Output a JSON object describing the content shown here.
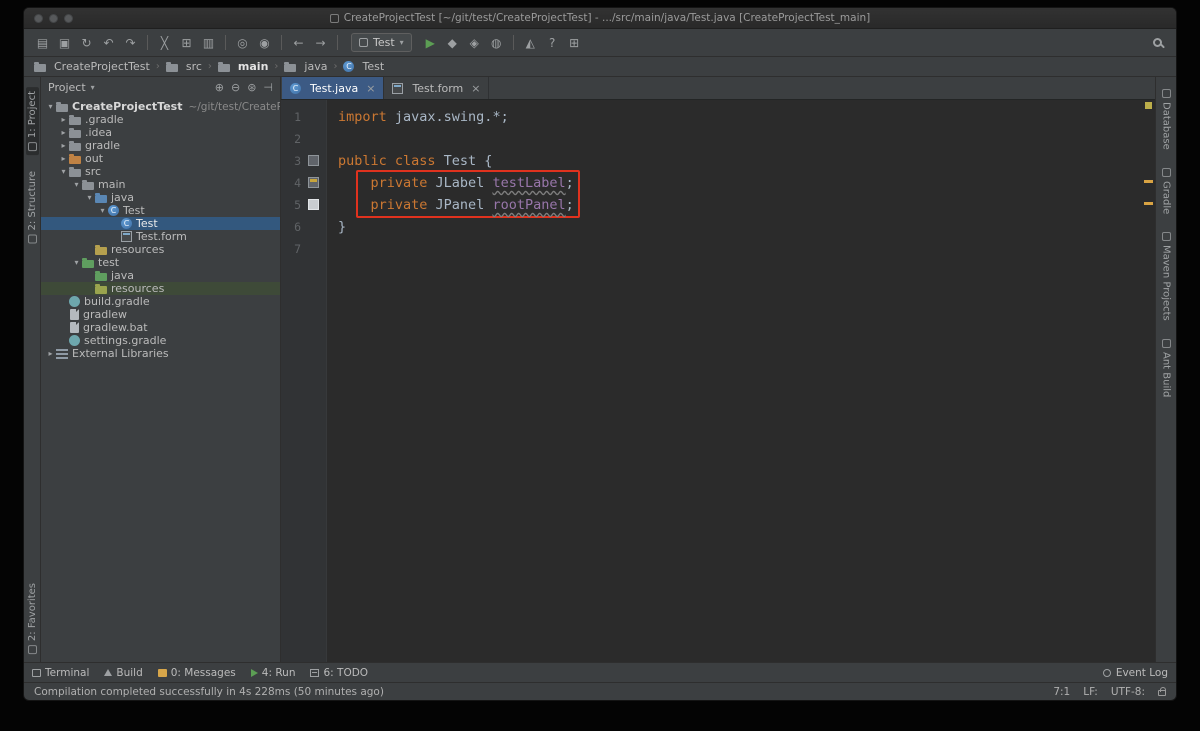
{
  "window": {
    "title": "CreateProjectTest [~/git/test/CreateProjectTest] - .../src/main/java/Test.java [CreateProjectTest_main]"
  },
  "toolbar": {
    "groups": [
      {
        "icons": [
          {
            "name": "open-icon",
            "glyph": "▤"
          },
          {
            "name": "save-all-icon",
            "glyph": "▣"
          },
          {
            "name": "synchronize-icon",
            "glyph": "↻"
          },
          {
            "name": "undo-icon",
            "glyph": "↶"
          },
          {
            "name": "redo-icon",
            "glyph": "↷"
          }
        ]
      },
      {
        "icons": [
          {
            "name": "cut-icon",
            "glyph": "╳"
          },
          {
            "name": "copy-icon",
            "glyph": "⊞"
          },
          {
            "name": "paste-icon",
            "glyph": "▥"
          }
        ]
      },
      {
        "icons": [
          {
            "name": "find-icon",
            "glyph": "◎"
          },
          {
            "name": "replace-icon",
            "glyph": "◉"
          }
        ]
      },
      {
        "icons": [
          {
            "name": "back-icon",
            "glyph": "←"
          },
          {
            "name": "forward-icon",
            "glyph": "→"
          }
        ]
      }
    ],
    "run_config_label": "Test",
    "run_icons": [
      {
        "name": "run-icon",
        "glyph": "▶",
        "color": "#5c9e54"
      },
      {
        "name": "debug-icon",
        "glyph": "◆",
        "color": "#9da0a2"
      },
      {
        "name": "coverage-icon",
        "glyph": "◈",
        "color": "#9da0a2"
      },
      {
        "name": "profiler-icon",
        "glyph": "◍",
        "color": "#9da0a2"
      }
    ],
    "extra_icons": [
      {
        "name": "build-project-icon",
        "glyph": "◭",
        "color": "#9da0a2"
      },
      {
        "name": "help-icon",
        "glyph": "?",
        "color": "#9da0a2"
      },
      {
        "name": "tool-windows-icon",
        "glyph": "⊞",
        "color": "#9da0a2"
      }
    ]
  },
  "breadcrumbs": [
    {
      "label": "CreateProjectTest",
      "icon": "project"
    },
    {
      "label": "src",
      "icon": "folder"
    },
    {
      "label": "main",
      "icon": "folder",
      "bold": true
    },
    {
      "label": "java",
      "icon": "folder"
    },
    {
      "label": "Test",
      "icon": "class"
    }
  ],
  "left_stripe": {
    "top": [
      {
        "label": "1: Project",
        "active": true
      },
      {
        "label": "2: Structure",
        "active": false
      }
    ],
    "bottom": [
      {
        "label": "2: Favorites",
        "active": false
      }
    ]
  },
  "right_stripe": [
    {
      "label": "Database"
    },
    {
      "label": "Gradle"
    },
    {
      "label": "Maven Projects"
    },
    {
      "label": "Ant Build"
    }
  ],
  "project_panel": {
    "title": "Project",
    "caret_glyph": "▾",
    "header_icons": [
      {
        "name": "expand-all-icon",
        "glyph": "⊕"
      },
      {
        "name": "collapse-all-icon",
        "glyph": "⊖"
      },
      {
        "name": "settings-icon",
        "glyph": "⊛"
      },
      {
        "name": "hide-panel-icon",
        "glyph": "⊣"
      }
    ],
    "tree": [
      {
        "label": "CreateProjectTest",
        "hint": "~/git/test/CreateProjectTest",
        "depth": 0,
        "arrow": "expanded",
        "icon": "project",
        "bold": true
      },
      {
        "label": ".gradle",
        "depth": 1,
        "arrow": "collapsed",
        "icon": "folder"
      },
      {
        "label": ".idea",
        "depth": 1,
        "arrow": "collapsed",
        "icon": "folder"
      },
      {
        "label": "gradle",
        "depth": 1,
        "arrow": "collapsed",
        "icon": "folder"
      },
      {
        "label": "out",
        "depth": 1,
        "arrow": "collapsed",
        "icon": "folder-out"
      },
      {
        "label": "src",
        "depth": 1,
        "arrow": "expanded",
        "icon": "folder"
      },
      {
        "label": "main",
        "depth": 2,
        "arrow": "expanded",
        "icon": "folder"
      },
      {
        "label": "java",
        "depth": 3,
        "arrow": "expanded",
        "icon": "folder-src"
      },
      {
        "label": "Test",
        "depth": 4,
        "arrow": "expanded",
        "icon": "class"
      },
      {
        "label": "Test",
        "depth": 5,
        "icon": "class",
        "selected": true
      },
      {
        "label": "Test.form",
        "depth": 5,
        "icon": "form"
      },
      {
        "label": "resources",
        "depth": 3,
        "icon": "folder-res"
      },
      {
        "label": "test",
        "depth": 2,
        "arrow": "expanded",
        "icon": "folder-test"
      },
      {
        "label": "java",
        "depth": 3,
        "icon": "folder-testsrc"
      },
      {
        "label": "resources",
        "depth": 3,
        "icon": "folder-testres",
        "highlight": true
      },
      {
        "label": "build.gradle",
        "depth": 1,
        "icon": "gradle"
      },
      {
        "label": "gradlew",
        "depth": 1,
        "icon": "file"
      },
      {
        "label": "gradlew.bat",
        "depth": 1,
        "icon": "file"
      },
      {
        "label": "settings.gradle",
        "depth": 1,
        "icon": "gradle"
      },
      {
        "label": "External Libraries",
        "depth": 0,
        "arrow": "collapsed",
        "icon": "libs"
      }
    ]
  },
  "editor": {
    "tabs": [
      {
        "label": "Test.java",
        "icon": "class",
        "active": true
      },
      {
        "label": "Test.form",
        "icon": "form",
        "active": false
      }
    ],
    "close_glyph": "×",
    "lines": [
      {
        "tokens": [
          {
            "t": "import ",
            "c": "kw"
          },
          {
            "t": "javax.swing.*;",
            "c": "pl"
          }
        ]
      },
      {
        "tokens": []
      },
      {
        "gutter": "form1",
        "tokens": [
          {
            "t": "public class ",
            "c": "kw"
          },
          {
            "t": "Test {",
            "c": "pl"
          }
        ]
      },
      {
        "gutter": "form2",
        "tokens": [
          {
            "t": "    ",
            "c": "pl"
          },
          {
            "t": "private ",
            "c": "kw"
          },
          {
            "t": "JLabel ",
            "c": "pl"
          },
          {
            "t": "testLabel",
            "c": "fw"
          },
          {
            "t": ";",
            "c": "pl"
          }
        ]
      },
      {
        "gutter": "square",
        "tokens": [
          {
            "t": "    ",
            "c": "pl"
          },
          {
            "t": "private ",
            "c": "kw"
          },
          {
            "t": "JPanel ",
            "c": "pl"
          },
          {
            "t": "rootPanel",
            "c": "fw"
          },
          {
            "t": ";",
            "c": "pl"
          }
        ]
      },
      {
        "tokens": [
          {
            "t": "}",
            "c": "pl"
          }
        ]
      },
      {
        "tokens": []
      }
    ]
  },
  "bottom_bar": {
    "items": [
      {
        "label": "Terminal",
        "icon": "terminal"
      },
      {
        "label": "Build",
        "icon": "build"
      },
      {
        "label": "0: Messages",
        "icon": "messages"
      },
      {
        "label": "4: Run",
        "icon": "run"
      },
      {
        "label": "6: TODO",
        "icon": "todo"
      }
    ],
    "event_log": "Event Log"
  },
  "status_bar": {
    "message": "Compilation completed successfully in 4s 228ms (50 minutes ago)",
    "caret": "7:1",
    "line_sep": "LF:",
    "encoding": "UTF-8:"
  },
  "colors": {
    "annotation_red": "#e0321e",
    "warning_orange": "#d9a343",
    "selection_blue": "#33587e",
    "keyword_orange": "#cc7832",
    "field_purple": "#9876aa",
    "editor_bg": "#2b2b2b",
    "panel_bg": "#3c3f41"
  }
}
